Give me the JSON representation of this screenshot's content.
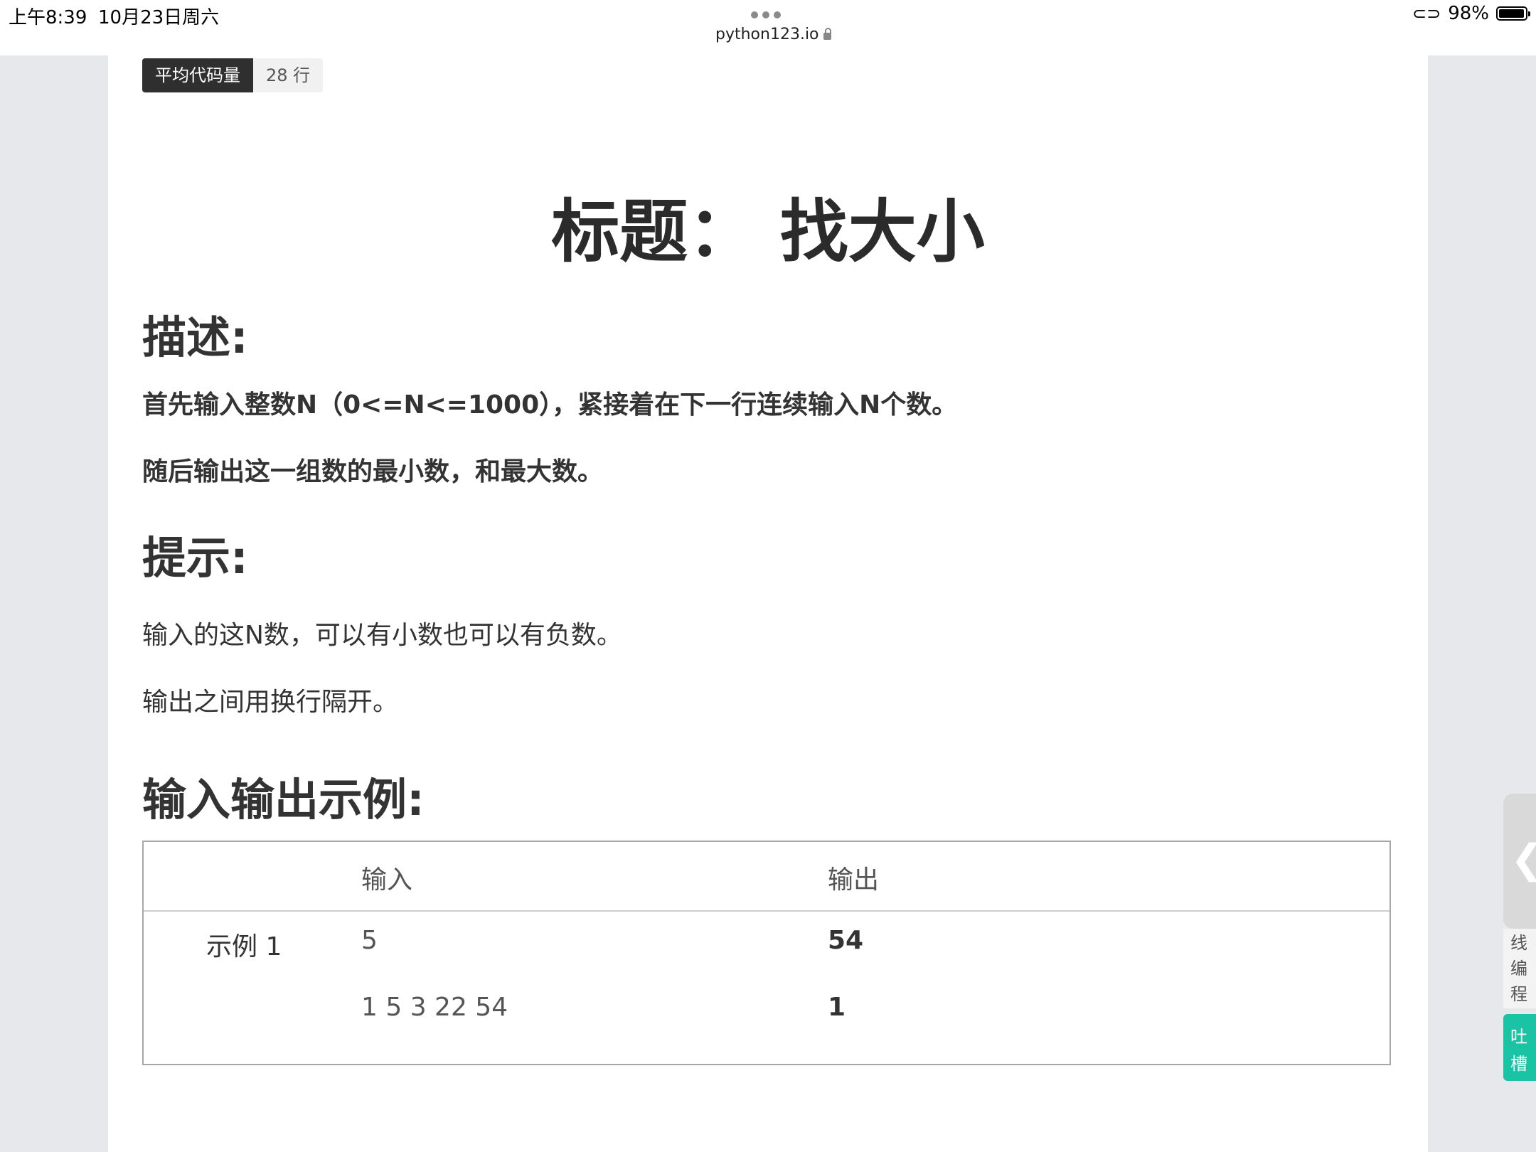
{
  "status_bar": {
    "time": "上午8:39",
    "date": "10月23日周六",
    "url": "python123.io",
    "battery": "98%"
  },
  "badge": {
    "label": "平均代码量",
    "value": "28 行"
  },
  "title": "标题： 找大小",
  "description": {
    "heading": "描述:",
    "lines": [
      "首先输入整数N（0<=N<=1000），紧接着在下一行连续输入N个数。",
      "随后输出这一组数的最小数，和最大数。"
    ]
  },
  "hint": {
    "heading": "提示:",
    "lines": [
      "输入的这N数，可以有小数也可以有负数。",
      "输出之间用换行隔开。"
    ]
  },
  "examples": {
    "heading": "输入输出示例:",
    "col_input": "输入",
    "col_output": "输出",
    "rows": [
      {
        "label": "示例 1",
        "input": [
          "5",
          "1 5 3 22 54"
        ],
        "output": [
          "54",
          "1"
        ]
      }
    ]
  },
  "side": {
    "chevron": "❮",
    "text_chars": [
      "线",
      "编",
      "程"
    ],
    "feedback_chars": [
      "吐",
      "槽"
    ]
  }
}
